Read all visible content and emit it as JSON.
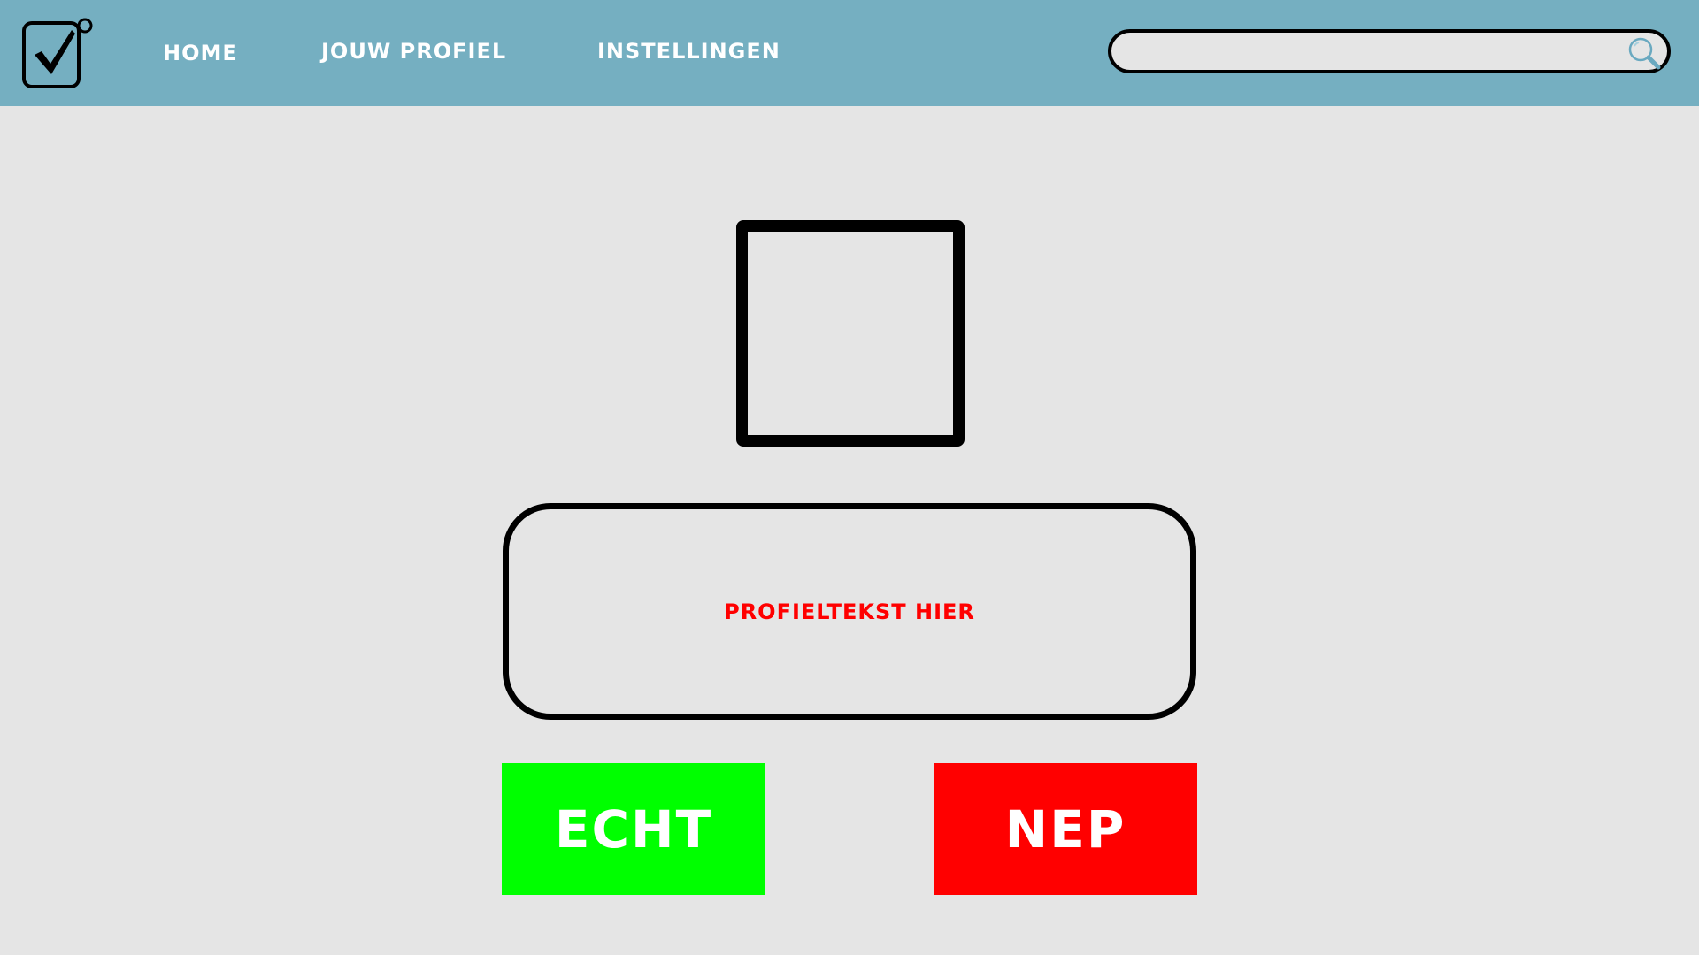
{
  "header": {
    "nav": {
      "home_label": "HOME",
      "profile_label": "JOUW PROFIEL",
      "settings_label": "INSTELLINGEN"
    },
    "search": {
      "value": "",
      "placeholder": "",
      "icon": "search-icon"
    },
    "logo_icon": "checkbox-check-icon"
  },
  "main": {
    "avatar_icon": "image-placeholder",
    "profile_text": "PROFIELTEKST HIER",
    "buttons": {
      "real_label": "ECHT",
      "fake_label": "NEP"
    }
  },
  "colors": {
    "header_bg": "#75afc1",
    "page_bg": "#e5e5e5",
    "real_button": "#00ff00",
    "fake_button": "#ff0000",
    "profile_text": "#ff0000"
  }
}
